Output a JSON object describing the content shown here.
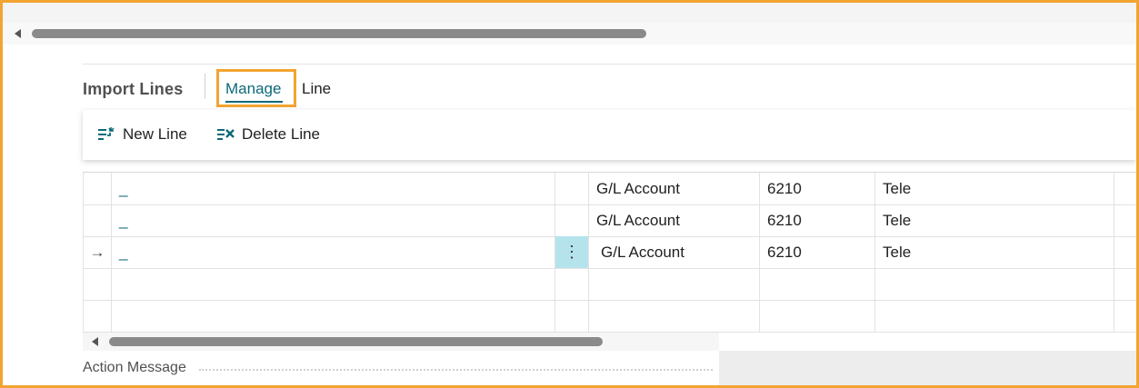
{
  "part": {
    "title": "Import Lines",
    "tabs": [
      {
        "label": "Manage"
      },
      {
        "label": "Line"
      }
    ]
  },
  "actions": [
    {
      "label": "New Line",
      "icon": "new-line-icon"
    },
    {
      "label": "Delete Line",
      "icon": "delete-line-icon"
    }
  ],
  "rows": [
    {
      "selector": "",
      "description": "_",
      "type": "G/L Account",
      "no": "6210",
      "desc2": "Tele"
    },
    {
      "selector": "",
      "description": "_",
      "type": "G/L Account",
      "no": "6210",
      "desc2": "Tele"
    },
    {
      "selector": "→",
      "description": "_",
      "menu": "⋮",
      "type": "G/L Account",
      "no": "6210",
      "desc2": "Tele"
    },
    {
      "selector": "",
      "description": "",
      "type": "",
      "no": "",
      "desc2": ""
    },
    {
      "selector": "",
      "description": "",
      "type": "",
      "no": "",
      "desc2": ""
    }
  ],
  "footer": {
    "label": "Action Message"
  },
  "colors": {
    "accent": "#0b6a78",
    "highlight_border": "#f2a431",
    "menu_cell_bg": "#b5e3ec"
  }
}
